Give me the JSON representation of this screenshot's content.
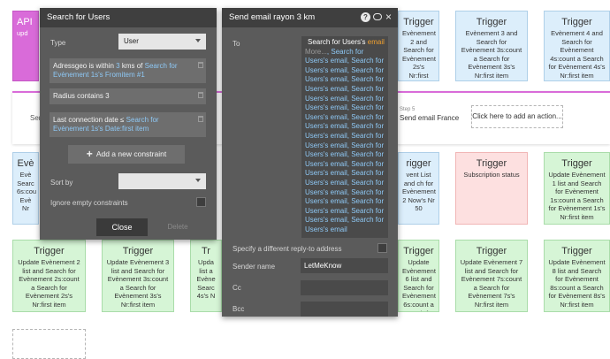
{
  "canvas": {
    "top_cards": [
      {
        "kind": "purple",
        "title": "API",
        "desc": "upd"
      },
      {
        "kind": "blue",
        "title": "Trigger",
        "desc": "Evènement 2 and Search for Evènement 2s's Nr:first item"
      },
      {
        "kind": "blue",
        "title": "Trigger",
        "desc": "Evènement 3 and Search for Evènement 3s:count a Search for Evènement 3s's Nr:first item"
      },
      {
        "kind": "blue",
        "title": "Trigger",
        "desc": "Evènement 4 and Search for Evènement 4s:count a Search for Evènement 4s's Nr:first item"
      }
    ],
    "step_bar": {
      "left_label": "Sen",
      "step_label": "Step 5",
      "step_name": "Send email France",
      "add_action": "Click here to add an action..."
    },
    "middle_cards": [
      {
        "kind": "blue",
        "title": "Evè",
        "desc": "Evè Searc 6s:cou Evè Nr"
      },
      {
        "kind": "blue",
        "title": "rigger",
        "desc": "vent List and ch for Evènement 2 Now's Nr 50"
      },
      {
        "kind": "pink",
        "title": "Trigger",
        "desc": "Subscription status"
      },
      {
        "kind": "green",
        "title": "Trigger",
        "desc": "Update Evènement 1 list and Search for Evènement 1s:count a Search for Evènement 1s's Nr:first item"
      }
    ],
    "bottom_cards": [
      {
        "kind": "green",
        "title": "Trigger",
        "desc": "Update Evènement 2 list and Search for Evènement 2s:count a Search for Evènement 2s's Nr:first item"
      },
      {
        "kind": "green",
        "title": "Trigger",
        "desc": "Update Evènement 3 list and Search for Evènement 3s:count a Search for Evènement 3s's Nr:first item"
      },
      {
        "kind": "green",
        "title": "Tr",
        "desc": "Upda list a Evène Searc 4s's N"
      },
      {
        "kind": "green",
        "title": "Trigger",
        "desc": "Update Evènement 6 list and Search for Evènement 6s:count a Search for Evènement 6s's Nr:first item"
      },
      {
        "kind": "green",
        "title": "Trigger",
        "desc": "Update Evènement 7 list and Search for Evènement 7s:count a Search for Evènement 7s's Nr:first item"
      },
      {
        "kind": "green",
        "title": "Trigger",
        "desc": "Update Evènement 8 list and Search for Evènement 8s:count a Search for Evènement 8s's Nr:first item"
      }
    ]
  },
  "search_panel": {
    "title": "Search for Users",
    "type_label": "Type",
    "type_value": "User",
    "constraints": [
      {
        "pre": "Adressgeo is within ",
        "num": "3",
        "mid": " kms of ",
        "link": "Search for Evènement 1s's Fromitem #1"
      },
      {
        "pre": "Radius contains ",
        "num": "3",
        "mid": "",
        "link": ""
      },
      {
        "pre": "Last connection date ≤ ",
        "num": "",
        "mid": "",
        "link": "Search for Evènement 1s's Date:first item"
      }
    ],
    "add_constraint": "Add a new constraint",
    "sort_label": "Sort by",
    "ignore_label": "Ignore empty constraints",
    "close": "Close",
    "delete": "Delete"
  },
  "email_panel": {
    "title": "Send email rayon 3 km",
    "to_label": "To",
    "to_first": "Search for Users's",
    "to_first_highlight": "email",
    "to_more": "More...",
    "to_item": "Search for Users's email",
    "to_item_count": 19,
    "reply_label": "Specify a different reply-to address",
    "sender_label": "Sender name",
    "sender_value": "LetMeKnow",
    "cc_label": "Cc",
    "bcc_label": "Bcc"
  },
  "colors": {
    "panel": "#5b5b5b",
    "header": "#3f3f3f",
    "link": "#8ec8f5",
    "accent": "#f0a030"
  }
}
